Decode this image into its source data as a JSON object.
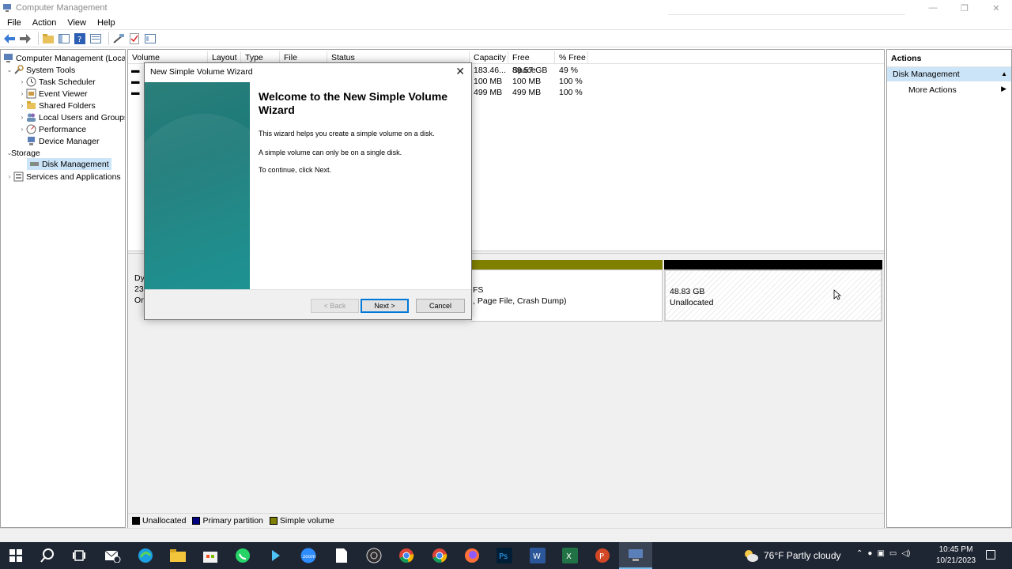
{
  "window": {
    "title": "Computer Management"
  },
  "menu": [
    "File",
    "Action",
    "View",
    "Help"
  ],
  "tree": {
    "items": [
      {
        "label": "Computer Management (Local)",
        "icon": "computer-management-icon"
      },
      {
        "label": "System Tools",
        "icon": "system-tools-icon"
      },
      {
        "label": "Task Scheduler",
        "icon": "task-scheduler-icon"
      },
      {
        "label": "Event Viewer",
        "icon": "event-viewer-icon"
      },
      {
        "label": "Shared Folders",
        "icon": "shared-folders-icon"
      },
      {
        "label": "Local Users and Groups",
        "icon": "users-icon"
      },
      {
        "label": "Performance",
        "icon": "performance-icon"
      },
      {
        "label": "Device Manager",
        "icon": "device-manager-icon"
      },
      {
        "label": "Storage",
        "icon": "storage-icon"
      },
      {
        "label": "Disk Management",
        "icon": "disk-icon"
      },
      {
        "label": "Services and Applications",
        "icon": "services-icon"
      }
    ]
  },
  "volumes": {
    "columns": [
      "Volume",
      "Layout",
      "Type",
      "File System",
      "Status",
      "Capacity",
      "Free Space",
      "% Free"
    ],
    "rows": [
      {
        "capacity": "183.46...",
        "free": "89.57 GB",
        "pct": "49 %"
      },
      {
        "capacity": "100 MB",
        "free": "100 MB",
        "pct": "100 %"
      },
      {
        "capacity": "499 MB",
        "free": "499 MB",
        "pct": "100 %"
      }
    ]
  },
  "disk": {
    "label_line1": "Dy",
    "label_line2": "23",
    "label_line3": "On",
    "partition_line1": "FS",
    "partition_line2": ", Page File, Crash Dump)",
    "unallocated_size": "48.83 GB",
    "unallocated_label": "Unallocated"
  },
  "legend": [
    {
      "label": "Unallocated",
      "color": "#000000"
    },
    {
      "label": "Primary partition",
      "color": "#000080"
    },
    {
      "label": "Simple volume",
      "color": "#808000"
    }
  ],
  "actions": {
    "header": "Actions",
    "section": "Disk Management",
    "more": "More Actions"
  },
  "wizard": {
    "title": "New Simple Volume Wizard",
    "heading": "Welcome to the New Simple Volume Wizard",
    "p1": "This wizard helps you create a simple volume on a disk.",
    "p2": "A simple volume can only be on a single disk.",
    "p3": "To continue, click Next.",
    "back": "< Back",
    "next": "Next >",
    "cancel": "Cancel"
  },
  "taskbar": {
    "weather": "76°F  Partly cloudy",
    "time": "10:45 PM",
    "date": "10/21/2023"
  },
  "colors": {
    "accent": "#0078d7",
    "selection": "#cce4f7",
    "olive": "#808000",
    "taskbar": "#1f2633"
  }
}
